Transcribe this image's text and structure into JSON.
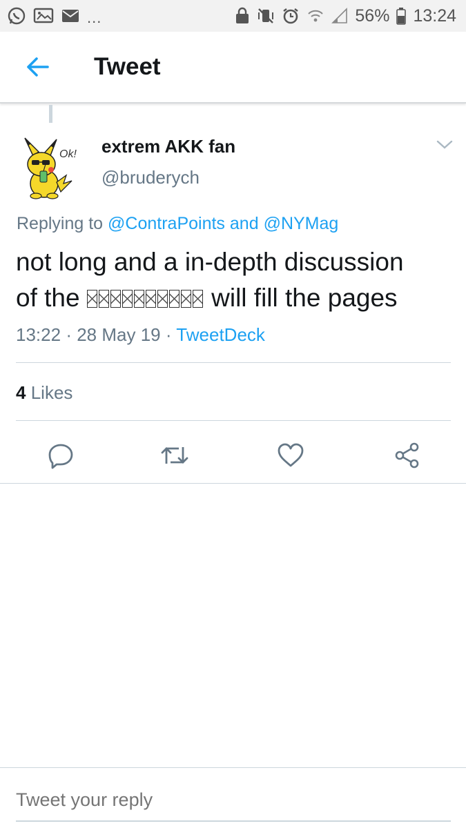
{
  "status_bar": {
    "overflow": "...",
    "battery": "56%",
    "time": "13:24",
    "icons_left": [
      "whatsapp-icon",
      "image-message-icon",
      "mail-icon"
    ],
    "icons_right": [
      "lock-icon",
      "mute-vibrate-icon",
      "alarm-icon",
      "wifi-icon",
      "signal-icon",
      "battery-icon"
    ]
  },
  "header": {
    "title": "Tweet",
    "back_icon": "arrow-left-icon",
    "accent": "#1da1f2"
  },
  "tweet": {
    "avatar_badge": "Ok!",
    "display_name": "extrem AKK fan",
    "handle": "@bruderych",
    "replying_prefix": "Replying to",
    "mention_1": "@ContraPoints",
    "mention_joiner": "and",
    "mention_2": "@NYMag",
    "text_line_1": "not long and a in-depth discussion",
    "text_before_glyphs": "of the ",
    "text_after_glyphs": " will fill the pages",
    "unrendered_glyph_count": 10,
    "time": "13:22",
    "date": "28 May 19",
    "separator": "·",
    "client": "TweetDeck",
    "likes_count": "4",
    "likes_label": "Likes"
  },
  "actions": [
    "reply-icon",
    "retweet-icon",
    "like-icon",
    "share-icon"
  ],
  "reply_bar": {
    "placeholder": "Tweet your reply"
  },
  "colors": {
    "link": "#1da1f2",
    "secondary_text": "#657786",
    "divider": "#ccd6dd"
  }
}
